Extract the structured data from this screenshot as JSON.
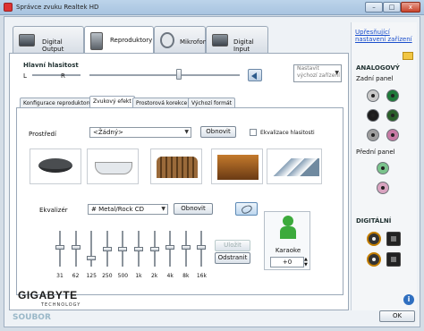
{
  "window": {
    "title": "Správce zvuku Realtek HD",
    "controls": [
      "–",
      "□",
      "x"
    ]
  },
  "tabs": [
    {
      "label": "Digital Output",
      "active": false
    },
    {
      "label": "Reproduktory",
      "active": true
    },
    {
      "label": "Mikrofon",
      "active": false
    },
    {
      "label": "Digital Input",
      "active": false
    }
  ],
  "master_volume": {
    "label": "Hlavní hlasitost",
    "left": "L",
    "right": "R",
    "balance": 0.5,
    "level": 0.55
  },
  "default_device_dropdown": {
    "value": "Nastavit výchozí zařízení"
  },
  "subtabs": [
    {
      "label": "Konfigurace reproduktorů",
      "active": false
    },
    {
      "label": "Zvukový efekt",
      "active": true
    },
    {
      "label": "Prostorová korekce",
      "active": false
    },
    {
      "label": "Výchozí formát",
      "active": false
    }
  ],
  "environment": {
    "label": "Prostředí",
    "value": "<Žádný>",
    "reset": "Obnovit",
    "loudness": "Ekvalizace hlasitosti"
  },
  "equalizer": {
    "label": "Ekvalizér",
    "preset": "# Metal/Rock CD",
    "reset": "Obnovit",
    "save": "Uložit",
    "remove": "Odstranit",
    "bands": [
      "31",
      "62",
      "125",
      "250",
      "500",
      "1k",
      "2k",
      "4k",
      "8k",
      "16k"
    ],
    "levels": [
      0.55,
      0.55,
      0.25,
      0.5,
      0.5,
      0.5,
      0.5,
      0.55,
      0.55,
      0.55
    ]
  },
  "karaoke": {
    "label": "Karaoke",
    "value": "+0"
  },
  "right_panel": {
    "link": "Upřesňující nastavení zařízení",
    "analog_title": "ANALOGOVÝ",
    "back_panel": "Zadní panel",
    "front_panel": "Přední panel",
    "digital_title": "DIGITÁLNÍ",
    "back_jacks": [
      "#c9c9c9",
      "#1f7a3a",
      "#1c1c1c",
      "#2a5f2a",
      "#9e9e9e",
      "#c77aa5"
    ],
    "front_jacks": [
      "#7ac48c",
      "#d9a3c0"
    ]
  },
  "footer": {
    "brand": "GIGABYTE",
    "brand_sub": "TECHNOLOGY",
    "watermark": "SOUBOR",
    "ok": "OK"
  }
}
